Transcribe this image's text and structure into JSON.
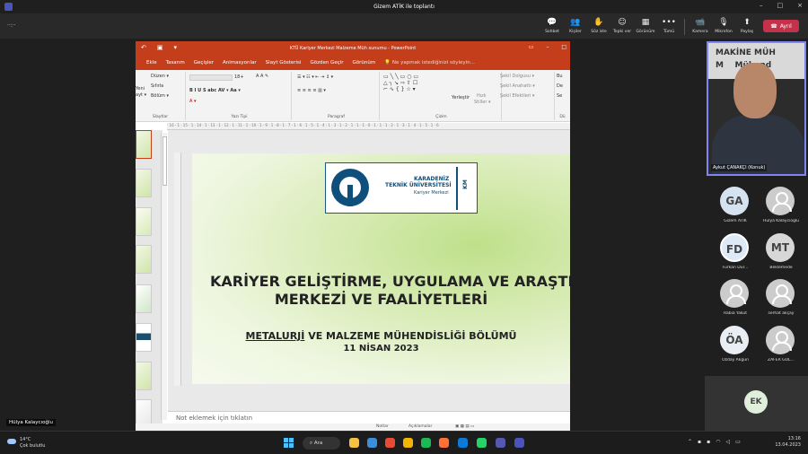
{
  "window": {
    "title": "Gizem ATİK ile toplantı",
    "controls": [
      "–",
      "□",
      "×"
    ]
  },
  "meeting": {
    "timer": "··:··",
    "tools": [
      {
        "icon": "chat-icon",
        "glyph": "💬",
        "label": "Sohbet"
      },
      {
        "icon": "people-icon",
        "glyph": "👥",
        "label": "Kişiler"
      },
      {
        "icon": "raise-hand-icon",
        "glyph": "✋",
        "label": "Söz iste"
      },
      {
        "icon": "react-icon",
        "glyph": "☺",
        "label": "Tepki ver"
      },
      {
        "icon": "view-icon",
        "glyph": "▦",
        "label": "Görünüm"
      },
      {
        "icon": "more-icon",
        "glyph": "•••",
        "label": "Tümü"
      },
      {
        "icon": "camera-icon",
        "glyph": "📹",
        "label": "Kamera"
      },
      {
        "icon": "mic-icon",
        "glyph": "🎙",
        "label": "Mikrofon"
      },
      {
        "icon": "share-icon",
        "glyph": "⬆",
        "label": "Paylaş"
      }
    ],
    "leave_label": "Ayrıl"
  },
  "powerpoint": {
    "title": "KTÜ Kariyer Merkezi Malzeme Müh sunumu  -  PowerPoint",
    "tabs": [
      "Ekle",
      "Tasarım",
      "Geçişler",
      "Animasyonlar",
      "Slayt Gösterisi",
      "Gözden Geçir",
      "Görünüm"
    ],
    "search_hint": "Ne yapmak istediğinizi söyleyin...",
    "ribbon": {
      "new_slide_1": "Yeni",
      "new_slide_2": "ayt ▾",
      "layout": "Düzen ▾",
      "reset": "Sıfırla",
      "section": "Bölüm ▾",
      "font_size": "18+",
      "arrange": "Yerleştir",
      "quick_styles_1": "Hızlı",
      "quick_styles_2": "Stiller ▾",
      "shape_fill": "Şekil Dolgusu ▾",
      "shape_outline": "Şekil Anahattı ▾",
      "shape_effects": "Şekil Efektleri ▾",
      "find_1": "Bu",
      "find_2": "De",
      "find_3": "Se",
      "groups": {
        "slides": "Slaytlar",
        "font": "Yazı Tipi",
        "paragraph": "Paragraf",
        "drawing": "Çizim",
        "editing": "Dü"
      }
    },
    "ruler": "· 16 · 1 · 15 · 1 · 14 · 1 · 13 · 1 · 12 · 1 · 11 · 1 · 10 · 1 · 9 · 1 · 8 · 1 · 7 · 1 · 6 · 1 · 5 · 1 · 4 · 1 · 3 · 1 · 2 · 1 · 1 · 1 · 0 · 1 · 1 · 1 · 2 · 1 · 3 · 1 · 4 · 1 · 5 · 1 · 6",
    "slide": {
      "logo_line1": "KARADENİZ",
      "logo_line2": "TEKNİK ÜNİVERSİTESİ",
      "logo_line3": "Kariyer Merkezi",
      "logo_mark": "KM",
      "title_line1": "KARİYER GELİŞTİRME, UYGULAMA VE ARAŞTIRMA",
      "title_line2": "MERKEZİ VE FAALİYETLERİ",
      "subtitle_main": "METALURJİ",
      "subtitle_rest": " VE MALZEME MÜHENDİSLİĞİ BÖLÜMÜ",
      "date": "11 NİSAN 2023"
    },
    "notes_placeholder": "Not eklemek için tıklatın",
    "status": {
      "notes": "Notlar",
      "comments": "Açıklamalar"
    }
  },
  "presenter_label": "Hülya Kalaycıoğlu",
  "participants": {
    "camera_name": "Aykut ÇANAKÇI (Konuk)",
    "camera_wall_text": "MAKİNE MÜH\nM    Mühend",
    "tiles": [
      {
        "initials": "GA",
        "name": "Gizem ATİK"
      },
      {
        "initials": "",
        "name": "Hülya Kalaycıoğlu"
      },
      {
        "initials": "FD",
        "name": "Furkan Dur..."
      },
      {
        "initials": "MT",
        "name": "Beklemede"
      },
      {
        "initials": "",
        "name": "Rabia Yakut"
      },
      {
        "initials": "",
        "name": "serhat akçay"
      },
      {
        "initials": "ÖA",
        "name": "Özday Akgün"
      },
      {
        "initials": "",
        "name": "ZAFER GÖL..."
      }
    ],
    "bottom_tile": "EK"
  },
  "taskbar": {
    "weather_temp": "14°C",
    "weather_desc": "Çok bulutlu",
    "search_label": "Ara",
    "time": "13:16",
    "date": "13.04.2023",
    "app_colors": [
      "#f5c242",
      "#3b8ed8",
      "#e84a35",
      "#f4b400",
      "#1db954",
      "#ff7139",
      "#0b7bd7",
      "#25d366",
      "#5558af",
      "#4b53bc"
    ]
  }
}
